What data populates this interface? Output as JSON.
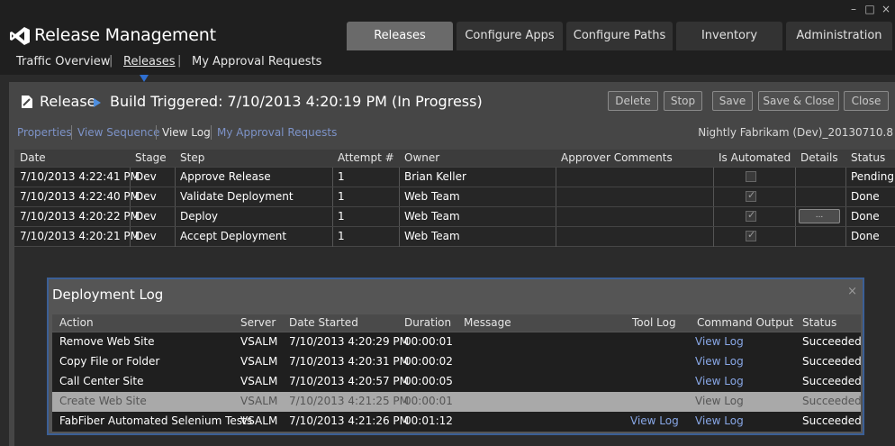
{
  "app": {
    "title": "Release Management",
    "window_controls": [
      "–",
      "□",
      "×"
    ]
  },
  "main_tabs": [
    {
      "label": "Releases",
      "active": true
    },
    {
      "label": "Configure Apps",
      "active": false
    },
    {
      "label": "Configure Paths",
      "active": false
    },
    {
      "label": "Inventory",
      "active": false
    },
    {
      "label": "Administration",
      "active": false
    }
  ],
  "subnav": [
    {
      "label": "Traffic Overview",
      "active": false
    },
    {
      "label": "Releases",
      "active": true
    },
    {
      "label": "My Approval Requests",
      "active": false
    }
  ],
  "release": {
    "label": "Release",
    "title": "Build Triggered: 7/10/2013 4:20:19 PM (In Progress)",
    "name": "Nightly Fabrikam (Dev)_20130710.8",
    "buttons": {
      "delete": "Delete",
      "stop": "Stop",
      "save": "Save",
      "save_close": "Save & Close",
      "close": "Close"
    },
    "tabs": [
      {
        "label": "Properties",
        "active": false
      },
      {
        "label": "View Sequence",
        "active": false
      },
      {
        "label": "View Log",
        "active": true
      },
      {
        "label": "My Approval Requests",
        "active": false
      }
    ]
  },
  "steps": {
    "columns": [
      "Date",
      "Stage",
      "Step",
      "Attempt #",
      "Owner",
      "Approver Comments",
      "Is Automated",
      "Details",
      "Status"
    ],
    "rows": [
      {
        "date": "7/10/2013 4:22:41 PM",
        "stage": "Dev",
        "step": "Approve Release",
        "attempt": "1",
        "owner": "Brian Keller",
        "comments": "",
        "automated": false,
        "details": "",
        "status": "Pending"
      },
      {
        "date": "7/10/2013 4:22:40 PM",
        "stage": "Dev",
        "step": "Validate Deployment",
        "attempt": "1",
        "owner": "Web Team",
        "comments": "",
        "automated": true,
        "details": "",
        "status": "Done"
      },
      {
        "date": "7/10/2013 4:20:22 PM",
        "stage": "Dev",
        "step": "Deploy",
        "attempt": "1",
        "owner": "Web Team",
        "comments": "",
        "automated": true,
        "details": "...",
        "status": "Done"
      },
      {
        "date": "7/10/2013 4:20:21 PM",
        "stage": "Dev",
        "step": "Accept Deployment",
        "attempt": "1",
        "owner": "Web Team",
        "comments": "",
        "automated": true,
        "details": "",
        "status": "Done"
      }
    ]
  },
  "deployment_log": {
    "title": "Deployment Log",
    "close": "×",
    "columns": [
      "Action",
      "Server",
      "Date Started",
      "Duration",
      "Message",
      "Tool Log",
      "Command Output",
      "Status"
    ],
    "rows": [
      {
        "action": "Remove Web Site",
        "server": "VSALM",
        "date": "7/10/2013 4:20:29 PM",
        "duration": "00:00:01",
        "message": "",
        "tool_log": "",
        "command_output": "View Log",
        "status": "Succeeded",
        "selected": false
      },
      {
        "action": "Copy File or Folder",
        "server": "VSALM",
        "date": "7/10/2013 4:20:31 PM",
        "duration": "00:00:02",
        "message": "",
        "tool_log": "",
        "command_output": "View Log",
        "status": "Succeeded",
        "selected": false
      },
      {
        "action": "Call Center Site",
        "server": "VSALM",
        "date": "7/10/2013 4:20:57 PM",
        "duration": "00:00:05",
        "message": "",
        "tool_log": "",
        "command_output": "View Log",
        "status": "Succeeded",
        "selected": false
      },
      {
        "action": "Create Web Site",
        "server": "VSALM",
        "date": "7/10/2013 4:21:25 PM",
        "duration": "00:00:01",
        "message": "",
        "tool_log": "",
        "command_output": "View Log",
        "status": "Succeeded",
        "selected": true
      },
      {
        "action": "FabFiber Automated Selenium Tests",
        "server": "VSALM",
        "date": "7/10/2013 4:21:26 PM",
        "duration": "00:01:12",
        "message": "",
        "tool_log": "View Log",
        "command_output": "View Log",
        "status": "Succeeded",
        "selected": false
      }
    ]
  },
  "colors": {
    "accent": "#2f6fd1",
    "link": "#88a7e6",
    "dialog_border": "#3b5f96"
  }
}
